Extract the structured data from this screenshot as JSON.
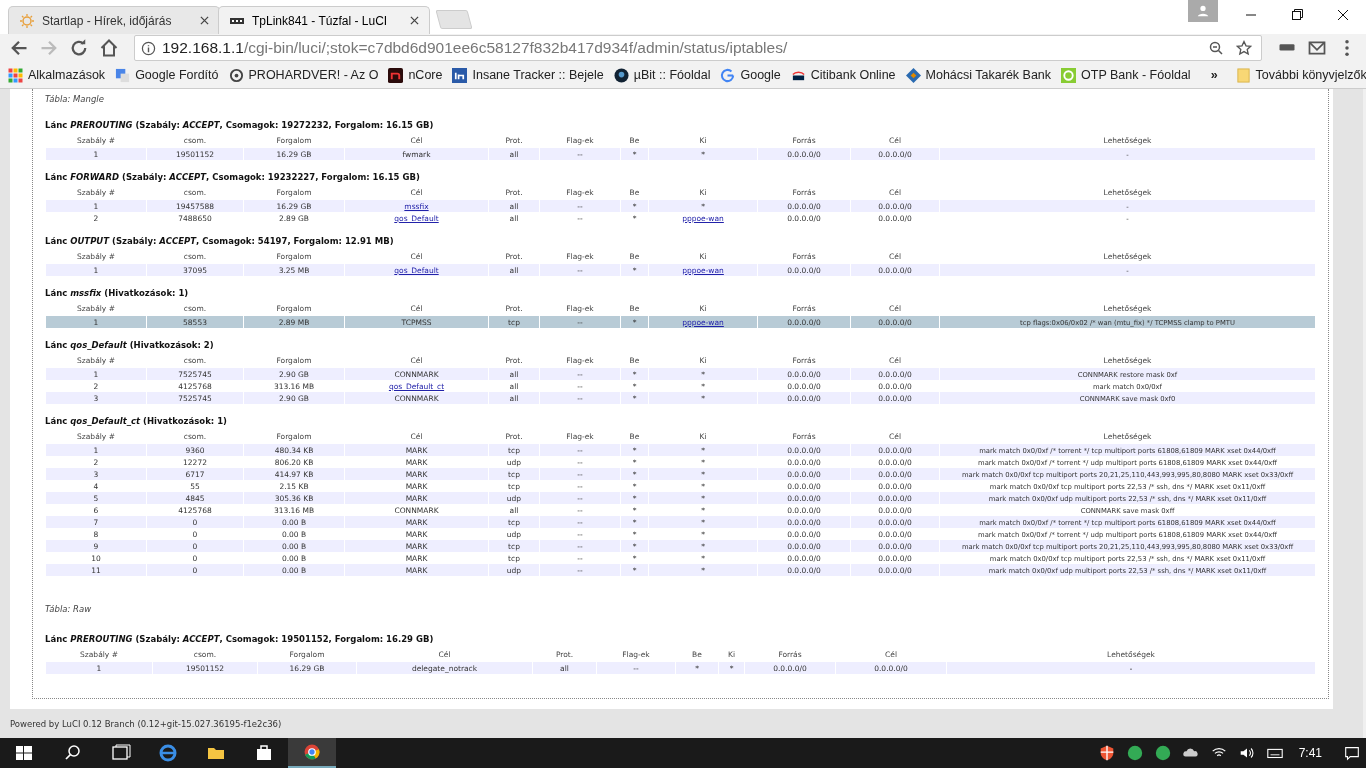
{
  "browser": {
    "tabs": [
      {
        "title": "Startlap - Hírek, időjárás",
        "selected": false
      },
      {
        "title": "TpLink841 - Túzfal - LuCI",
        "selected": true
      }
    ],
    "address": {
      "host": "192.168.1.1",
      "path": "/cgi-bin/luci/;stok=c7dbd6d901ee6c58127f832b417d934f/admin/status/iptables/"
    },
    "bookmarks": [
      {
        "label": "Alkalmazások",
        "kind": "apps"
      },
      {
        "label": "Google Fordító",
        "kind": "translate"
      },
      {
        "label": "PROHARDVER! - Az O",
        "kind": "ring"
      },
      {
        "label": "nCore",
        "kind": "ncore"
      },
      {
        "label": "Insane Tracker :: Bejele",
        "kind": "in"
      },
      {
        "label": "µBit :: Fóoldal",
        "kind": "ubit"
      },
      {
        "label": "Google",
        "kind": "google"
      },
      {
        "label": "Citibank Online",
        "kind": "citi"
      },
      {
        "label": "Mohácsi Takarék Bank",
        "kind": "diamond"
      },
      {
        "label": "OTP Bank - Fóoldal",
        "kind": "otp"
      }
    ],
    "more": "»",
    "other_bookmarks": "További könyvjelzők"
  },
  "tables": [
    {
      "title": "Tábla: Mangle",
      "chains": [
        {
          "title": "Lánc *PREROUTING* (Szabály: *ACCEPT*, Csomagok: 19272232, Forgalom: 16.15 GB)",
          "columns": [
            "Szabály #",
            "csom.",
            "Forgalom",
            "Cél",
            "Prot.",
            "Flag-ek",
            "Be",
            "Ki",
            "Forrás",
            "Cél",
            "Lehetőségek"
          ],
          "rows": [
            {
              "cells": [
                "1",
                "19501152",
                "16.29 GB",
                "fwmark",
                "all",
                "--",
                "*",
                "*",
                "0.0.0.0/0",
                "0.0.0.0/0",
                "-"
              ],
              "target_link": false,
              "out_link": false,
              "highlighted": false
            }
          ]
        },
        {
          "title": "Lánc *FORWARD* (Szabály: *ACCEPT*, Csomagok: 19232227, Forgalom: 16.15 GB)",
          "columns": [
            "Szabály #",
            "csom.",
            "Forgalom",
            "Cél",
            "Prot.",
            "Flag-ek",
            "Be",
            "Ki",
            "Forrás",
            "Cél",
            "Lehetőségek"
          ],
          "rows": [
            {
              "cells": [
                "1",
                "19457588",
                "16.29 GB",
                "mssfix",
                "all",
                "--",
                "*",
                "*",
                "0.0.0.0/0",
                "0.0.0.0/0",
                "-"
              ],
              "target_link": true,
              "out_link": false,
              "highlighted": false
            },
            {
              "cells": [
                "2",
                "7488650",
                "2.89 GB",
                "qos_Default",
                "all",
                "--",
                "*",
                "pppoe-wan",
                "0.0.0.0/0",
                "0.0.0.0/0",
                "-"
              ],
              "target_link": true,
              "out_link": true,
              "highlighted": false
            }
          ]
        },
        {
          "title": "Lánc *OUTPUT* (Szabály: *ACCEPT*, Csomagok: 54197, Forgalom: 12.91 MB)",
          "columns": [
            "Szabály #",
            "csom.",
            "Forgalom",
            "Cél",
            "Prot.",
            "Flag-ek",
            "Be",
            "Ki",
            "Forrás",
            "Cél",
            "Lehetőségek"
          ],
          "rows": [
            {
              "cells": [
                "1",
                "37095",
                "3.25 MB",
                "qos_Default",
                "all",
                "--",
                "*",
                "pppoe-wan",
                "0.0.0.0/0",
                "0.0.0.0/0",
                "-"
              ],
              "target_link": true,
              "out_link": true,
              "highlighted": false
            }
          ]
        },
        {
          "title": "Lánc *mssfix* (Hivatkozások: 1)",
          "columns": [
            "Szabály #",
            "csom.",
            "Forgalom",
            "Cél",
            "Prot.",
            "Flag-ek",
            "Be",
            "Ki",
            "Forrás",
            "Cél",
            "Lehetőségek"
          ],
          "rows": [
            {
              "cells": [
                "1",
                "58553",
                "2.89 MB",
                "TCPMSS",
                "tcp",
                "--",
                "*",
                "pppoe-wan",
                "0.0.0.0/0",
                "0.0.0.0/0",
                "tcp flags:0x06/0x02 /* wan (mtu_fix) */ TCPMSS clamp to PMTU"
              ],
              "target_link": false,
              "out_link": true,
              "highlighted": true
            }
          ]
        },
        {
          "title": "Lánc *qos_Default* (Hivatkozások: 2)",
          "columns": [
            "Szabály #",
            "csom.",
            "Forgalom",
            "Cél",
            "Prot.",
            "Flag-ek",
            "Be",
            "Ki",
            "Forrás",
            "Cél",
            "Lehetőségek"
          ],
          "rows": [
            {
              "cells": [
                "1",
                "7525745",
                "2.90 GB",
                "CONNMARK",
                "all",
                "--",
                "*",
                "*",
                "0.0.0.0/0",
                "0.0.0.0/0",
                "CONNMARK restore mask 0xf"
              ],
              "target_link": false,
              "out_link": false,
              "highlighted": false
            },
            {
              "cells": [
                "2",
                "4125768",
                "313.16 MB",
                "qos_Default_ct",
                "all",
                "--",
                "*",
                "*",
                "0.0.0.0/0",
                "0.0.0.0/0",
                "mark match 0x0/0xf"
              ],
              "target_link": true,
              "out_link": false,
              "highlighted": false
            },
            {
              "cells": [
                "3",
                "7525745",
                "2.90 GB",
                "CONNMARK",
                "all",
                "--",
                "*",
                "*",
                "0.0.0.0/0",
                "0.0.0.0/0",
                "CONNMARK save mask 0xf0"
              ],
              "target_link": false,
              "out_link": false,
              "highlighted": false
            }
          ]
        },
        {
          "title": "Lánc *qos_Default_ct* (Hivatkozások: 1)",
          "columns": [
            "Szabály #",
            "csom.",
            "Forgalom",
            "Cél",
            "Prot.",
            "Flag-ek",
            "Be",
            "Ki",
            "Forrás",
            "Cél",
            "Lehetőségek"
          ],
          "rows": [
            {
              "cells": [
                "1",
                "9360",
                "480.34 KB",
                "MARK",
                "tcp",
                "--",
                "*",
                "*",
                "0.0.0.0/0",
                "0.0.0.0/0",
                "mark match 0x0/0xf /* torrent */ tcp multiport ports 61808,61809 MARK xset 0x44/0xff"
              ],
              "target_link": false,
              "out_link": false,
              "highlighted": false
            },
            {
              "cells": [
                "2",
                "12272",
                "806.20 KB",
                "MARK",
                "udp",
                "--",
                "*",
                "*",
                "0.0.0.0/0",
                "0.0.0.0/0",
                "mark match 0x0/0xf /* torrent */ udp multiport ports 61808,61809 MARK xset 0x44/0xff"
              ],
              "target_link": false,
              "out_link": false,
              "highlighted": false
            },
            {
              "cells": [
                "3",
                "6717",
                "414.97 KB",
                "MARK",
                "tcp",
                "--",
                "*",
                "*",
                "0.0.0.0/0",
                "0.0.0.0/0",
                "mark match 0x0/0xf tcp multiport ports 20,21,25,110,443,993,995,80,8080 MARK xset 0x33/0xff"
              ],
              "target_link": false,
              "out_link": false,
              "highlighted": false
            },
            {
              "cells": [
                "4",
                "55",
                "2.15 KB",
                "MARK",
                "tcp",
                "--",
                "*",
                "*",
                "0.0.0.0/0",
                "0.0.0.0/0",
                "mark match 0x0/0xf tcp multiport ports 22,53 /* ssh, dns */ MARK xset 0x11/0xff"
              ],
              "target_link": false,
              "out_link": false,
              "highlighted": false
            },
            {
              "cells": [
                "5",
                "4845",
                "305.36 KB",
                "MARK",
                "udp",
                "--",
                "*",
                "*",
                "0.0.0.0/0",
                "0.0.0.0/0",
                "mark match 0x0/0xf udp multiport ports 22,53 /* ssh, dns */ MARK xset 0x11/0xff"
              ],
              "target_link": false,
              "out_link": false,
              "highlighted": false
            },
            {
              "cells": [
                "6",
                "4125768",
                "313.16 MB",
                "CONNMARK",
                "all",
                "--",
                "*",
                "*",
                "0.0.0.0/0",
                "0.0.0.0/0",
                "CONNMARK save mask 0xff"
              ],
              "target_link": false,
              "out_link": false,
              "highlighted": false
            },
            {
              "cells": [
                "7",
                "0",
                "0.00 B",
                "MARK",
                "tcp",
                "--",
                "*",
                "*",
                "0.0.0.0/0",
                "0.0.0.0/0",
                "mark match 0x0/0xf /* torrent */ tcp multiport ports 61808,61809 MARK xset 0x44/0xff"
              ],
              "target_link": false,
              "out_link": false,
              "highlighted": false
            },
            {
              "cells": [
                "8",
                "0",
                "0.00 B",
                "MARK",
                "udp",
                "--",
                "*",
                "*",
                "0.0.0.0/0",
                "0.0.0.0/0",
                "mark match 0x0/0xf /* torrent */ udp multiport ports 61808,61809 MARK xset 0x44/0xff"
              ],
              "target_link": false,
              "out_link": false,
              "highlighted": false
            },
            {
              "cells": [
                "9",
                "0",
                "0.00 B",
                "MARK",
                "tcp",
                "--",
                "*",
                "*",
                "0.0.0.0/0",
                "0.0.0.0/0",
                "mark match 0x0/0xf tcp multiport ports 20,21,25,110,443,993,995,80,8080 MARK xset 0x33/0xff"
              ],
              "target_link": false,
              "out_link": false,
              "highlighted": false
            },
            {
              "cells": [
                "10",
                "0",
                "0.00 B",
                "MARK",
                "tcp",
                "--",
                "*",
                "*",
                "0.0.0.0/0",
                "0.0.0.0/0",
                "mark match 0x0/0xf tcp multiport ports 22,53 /* ssh, dns */ MARK xset 0x11/0xff"
              ],
              "target_link": false,
              "out_link": false,
              "highlighted": false
            },
            {
              "cells": [
                "11",
                "0",
                "0.00 B",
                "MARK",
                "udp",
                "--",
                "*",
                "*",
                "0.0.0.0/0",
                "0.0.0.0/0",
                "mark match 0x0/0xf udp multiport ports 22,53 /* ssh, dns */ MARK xset 0x11/0xff"
              ],
              "target_link": false,
              "out_link": false,
              "highlighted": false
            }
          ]
        }
      ]
    },
    {
      "title": "Tábla: Raw",
      "chains": [
        {
          "title": "Lánc *PREROUTING* (Szabály: *ACCEPT*, Csomagok: 19501152, Forgalom: 16.29 GB)",
          "columns": [
            "Szabály #",
            "csom.",
            "Forgalom",
            "Cél",
            "Prot.",
            "Flag-ek",
            "Be",
            "Ki",
            "Forrás",
            "Cél",
            "Lehetőségek"
          ],
          "rows": [
            {
              "cells": [
                "1",
                "19501152",
                "16.29 GB",
                "delegate_notrack",
                "all",
                "--",
                "*",
                "*",
                "0.0.0.0/0",
                "0.0.0.0/0",
                "-"
              ],
              "target_link": false,
              "out_link": false,
              "highlighted": false
            }
          ]
        }
      ]
    }
  ],
  "footer": "Powered by LuCI 0.12 Branch (0.12+git-15.027.36195-f1e2c36)",
  "taskbar": {
    "time": "7:41"
  }
}
